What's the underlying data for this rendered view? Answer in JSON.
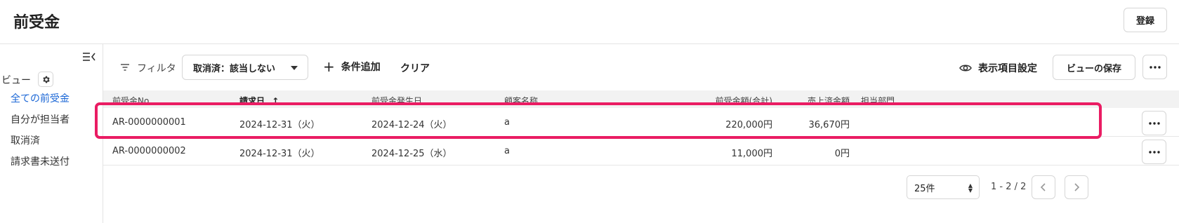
{
  "header": {
    "title": "前受金",
    "register_label": "登録"
  },
  "sidebar": {
    "view_label": "ビュー",
    "items": [
      {
        "label": "全ての前受金",
        "active": true
      },
      {
        "label": "自分が担当者",
        "active": false
      },
      {
        "label": "取消済",
        "active": false
      },
      {
        "label": "請求書未送付",
        "active": false
      }
    ]
  },
  "toolbar": {
    "filter_label": "フィルタ",
    "filter_chip": "取消済：該当しない",
    "add_condition_label": "条件追加",
    "clear_label": "クリア",
    "display_settings_label": "表示項目設定",
    "save_view_label": "ビューの保存"
  },
  "table": {
    "columns": [
      "前受金No.",
      "請求日",
      "前受金発生日",
      "顧客名称",
      "前受金額(合計)",
      "売上済金額",
      "担当部門"
    ],
    "sort_indicator": "↑",
    "rows": [
      {
        "no": "AR-0000000001",
        "invoice_date": "2024-12-31（火）",
        "occurred_date": "2024-12-24（火）",
        "customer": "a",
        "amount_total": "220,000円",
        "sold_amount": "36,670円",
        "department": ""
      },
      {
        "no": "AR-0000000002",
        "invoice_date": "2024-12-31（火）",
        "occurred_date": "2024-12-25（水）",
        "customer": "a",
        "amount_total": "11,000円",
        "sold_amount": "0円",
        "department": ""
      }
    ]
  },
  "pagination": {
    "page_size": "25件",
    "range": "1 - 2 / 2"
  },
  "colors": {
    "highlight": "#ea1c63",
    "active_link": "#1a66d6"
  }
}
